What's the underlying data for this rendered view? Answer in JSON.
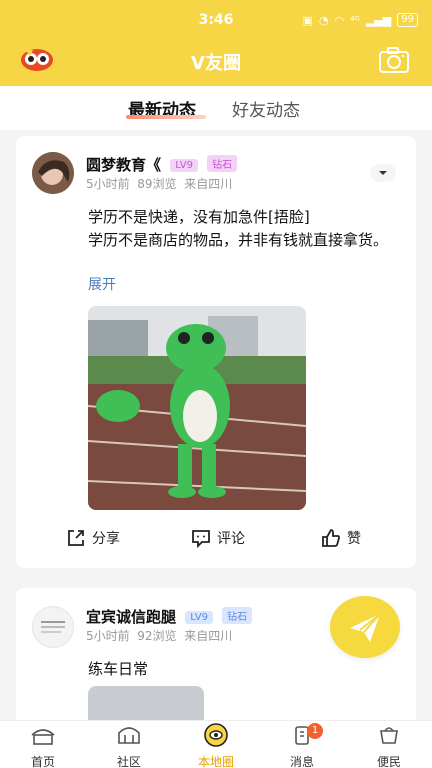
{
  "status_bar": {
    "time": "3:46",
    "network": "⁴ᴳ",
    "battery": "99"
  },
  "header": {
    "title": "V友圈"
  },
  "tabs": [
    {
      "label": "最新动态",
      "active": true
    },
    {
      "label": "好友动态",
      "active": false
    }
  ],
  "posts": [
    {
      "username": "圆梦教育《",
      "level": "LV9",
      "tier": "钻石",
      "time": "5小时前",
      "views": "89浏览",
      "source": "来自四川",
      "text_line1": "学历不是快递，没有加急件[捂脸]",
      "text_line2": "学历不是商店的物品，并非有钱就直接拿货。",
      "expand": "展开",
      "actions": {
        "share": "分享",
        "comment": "评论",
        "like": "赞"
      }
    },
    {
      "username": "宜宾诚信跑腿",
      "level": "LV9",
      "tier": "钻石",
      "time": "5小时前",
      "views": "92浏览",
      "source": "来自四川",
      "text": "练车日常"
    }
  ],
  "bottom_nav": [
    {
      "label": "首页",
      "icon": "home-icon"
    },
    {
      "label": "社区",
      "icon": "community-icon"
    },
    {
      "label": "本地圈",
      "icon": "local-circle-icon",
      "active": true
    },
    {
      "label": "消息",
      "icon": "message-icon",
      "badge": "1"
    },
    {
      "label": "便民",
      "icon": "service-icon"
    }
  ],
  "colors": {
    "brand": "#f7d646",
    "active_nav": "#e0a300",
    "link": "#4a7cc0"
  }
}
